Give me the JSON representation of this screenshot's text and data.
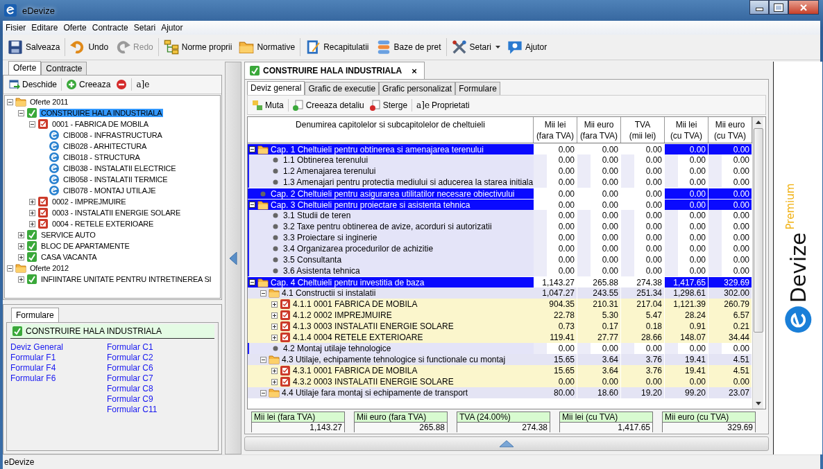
{
  "window": {
    "title": "eDevize"
  },
  "menu": [
    "Fisier",
    "Editare",
    "Oferte",
    "Contracte",
    "Setari",
    "Ajutor"
  ],
  "toolbar": [
    [
      {
        "label": "Salveaza",
        "kind": "save",
        "disabled": false,
        "dropdown": false
      }
    ],
    [
      {
        "label": "Undo",
        "kind": "undo",
        "disabled": false,
        "dropdown": false
      },
      {
        "label": "Redo",
        "kind": "redo",
        "disabled": true,
        "dropdown": false
      }
    ],
    [
      {
        "label": "Norme proprii",
        "kind": "tree",
        "disabled": false,
        "dropdown": false
      },
      {
        "label": "Normative",
        "kind": "folder",
        "disabled": false,
        "dropdown": false
      }
    ],
    [
      {
        "label": "Recapitulatii",
        "kind": "report",
        "disabled": false,
        "dropdown": false
      },
      {
        "label": "Baze de pret",
        "kind": "database",
        "disabled": false,
        "dropdown": false
      }
    ],
    [
      {
        "label": "Setari",
        "kind": "tools",
        "disabled": false,
        "dropdown": true
      },
      {
        "label": "Ajutor",
        "kind": "help",
        "disabled": false,
        "dropdown": false
      }
    ]
  ],
  "left_tabs": [
    {
      "label": "Oferte",
      "selected": true
    },
    {
      "label": "Contracte",
      "selected": false
    }
  ],
  "left_toolbar": [
    [
      {
        "label": "Deschide",
        "kind": "open"
      }
    ],
    [
      {
        "label": "Creeaza",
        "kind": "add"
      },
      {
        "kind": "remove"
      }
    ],
    [
      {
        "kind": "rename",
        "glyph": "a]e"
      }
    ]
  ],
  "tree": [
    {
      "label": "Oferte 2011",
      "kind": "folder",
      "expanded": true,
      "selected": false,
      "children": [
        {
          "label": "CONSTRUIRE HALA INDUSTRIALA",
          "kind": "project",
          "expanded": true,
          "selected": true,
          "children": [
            {
              "label": "0001 - FABRICA DE MOBILA",
              "kind": "object",
              "expanded": true,
              "selected": false,
              "children": [
                {
                  "label": "CIB008 - INFRASTRUCTURA",
                  "kind": "catalog",
                  "selected": false
                },
                {
                  "label": "CIB028 - ARHITECTURA",
                  "kind": "catalog",
                  "selected": false
                },
                {
                  "label": "CIB018 - STRUCTURA",
                  "kind": "catalog",
                  "selected": false
                },
                {
                  "label": "CIB038 - INSTALATII ELECTRICE",
                  "kind": "catalog",
                  "selected": false
                },
                {
                  "label": "CIB058 - INSTALATII TERMICE",
                  "kind": "catalog",
                  "selected": false
                },
                {
                  "label": "CIB078 - MONTAJ UTILAJE",
                  "kind": "catalog",
                  "selected": false
                }
              ]
            },
            {
              "label": "0002 - IMPREJMUIRE",
              "kind": "object",
              "expanded": false,
              "selected": false
            },
            {
              "label": "0003 - INSTALATII ENERGIE SOLARE",
              "kind": "object",
              "expanded": false,
              "selected": false
            },
            {
              "label": "0004 - RETELE EXTERIOARE",
              "kind": "object",
              "expanded": false,
              "selected": false
            }
          ]
        },
        {
          "label": "SERVICE AUTO",
          "kind": "project",
          "expanded": false,
          "selected": false
        },
        {
          "label": "BLOC DE APARTAMENTE",
          "kind": "project",
          "expanded": false,
          "selected": false
        },
        {
          "label": "CASA VACANTA",
          "kind": "project",
          "expanded": false,
          "selected": false
        }
      ]
    },
    {
      "label": "Oferte 2012",
      "kind": "folder",
      "expanded": true,
      "selected": false,
      "children": [
        {
          "label": "INFIINTARE UNITATE PENTRU INTRETINEREA SI",
          "kind": "project",
          "expanded": false,
          "selected": false
        }
      ]
    }
  ],
  "formulare": {
    "tab": "Formulare",
    "project": "CONSTRUIRE HALA INDUSTRIALA",
    "columns": [
      [
        "Deviz General",
        "Formular F1",
        "Formular F4",
        "Formular F6"
      ],
      [
        "Formular C1",
        "Formular C2",
        "Formular C6",
        "Formular C7",
        "Formular C8",
        "Formular C9",
        "Formular C11"
      ]
    ]
  },
  "document": {
    "tab": {
      "label": "CONSTRUIRE HALA INDUSTRIALA",
      "close": "×"
    },
    "tabs": [
      {
        "label": "Deviz general",
        "selected": true
      },
      {
        "label": "Grafic de executie",
        "selected": false
      },
      {
        "label": "Grafic personalizat",
        "selected": false
      },
      {
        "label": "Formulare",
        "selected": false
      }
    ],
    "toolbar": [
      [
        {
          "label": "Muta",
          "kind": "move"
        }
      ],
      [
        {
          "label": "Creeaza detaliu",
          "kind": "add-doc"
        },
        {
          "label": "Sterge",
          "kind": "delete-doc"
        }
      ],
      [
        {
          "label": "Proprietati",
          "kind": "rename",
          "glyph": "a]e"
        }
      ]
    ],
    "columns": [
      {
        "label": "Denumirea capitolelor si subcapitolelor de cheltuieli"
      },
      {
        "label": "Mii lei",
        "unit": "(fara TVA)"
      },
      {
        "label": "Mii euro",
        "unit": "(fara TVA)"
      },
      {
        "label": "TVA",
        "unit": "(mii lei)"
      },
      {
        "label": "Mii lei",
        "unit": "(cu TVA)"
      },
      {
        "label": "Mii euro",
        "unit": "(cu TVA)"
      }
    ],
    "rows": [
      {
        "kind": "chapter",
        "label": "Cap. 1 Cheltuieli pentru obtinerea si amenajarea terenului",
        "expanded": true,
        "values": [
          "0.00",
          "0.00",
          "0.00",
          "0.00",
          "0.00"
        ],
        "children": [
          {
            "kind": "item",
            "label": "1.1 Obtinerea terenului",
            "values": [
              "0.00",
              "0.00",
              "0.00",
              "0.00",
              "0.00"
            ]
          },
          {
            "kind": "item",
            "label": "1.2 Amenajarea terenului",
            "values": [
              "0.00",
              "0.00",
              "0.00",
              "0.00",
              "0.00"
            ]
          },
          {
            "kind": "item",
            "label": "1.3 Amenajari pentru protectia mediului si aducerea la starea initiala",
            "values": [
              "0.00",
              "0.00",
              "0.00",
              "0.00",
              "0.00"
            ]
          }
        ]
      },
      {
        "kind": "chapter",
        "label": "Cap. 2 Cheltuieli pentru asigurarea utilitatilor necesare obiectivului",
        "values": [
          "0.00",
          "0.00",
          "0.00",
          "0.00",
          "0.00"
        ]
      },
      {
        "kind": "chapter",
        "label": "Cap. 3 Cheltuieli pentru proiectare si asistenta tehnica",
        "expanded": true,
        "values": [
          "0.00",
          "0.00",
          "0.00",
          "0.00",
          "0.00"
        ],
        "children": [
          {
            "kind": "item",
            "label": "3.1 Studii de teren",
            "values": [
              "0.00",
              "0.00",
              "0.00",
              "0.00",
              "0.00"
            ]
          },
          {
            "kind": "item",
            "label": "3.2 Taxe pentru obtinerea de avize, acorduri si autorizatii",
            "values": [
              "0.00",
              "0.00",
              "0.00",
              "0.00",
              "0.00"
            ]
          },
          {
            "kind": "item",
            "label": "3.3 Proiectare si inginerie",
            "values": [
              "0.00",
              "0.00",
              "0.00",
              "0.00",
              "0.00"
            ]
          },
          {
            "kind": "item",
            "label": "3.4 Organizarea procedurilor de achizitie",
            "values": [
              "0.00",
              "0.00",
              "0.00",
              "0.00",
              "0.00"
            ]
          },
          {
            "kind": "item",
            "label": "3.5 Consultanta",
            "values": [
              "0.00",
              "0.00",
              "0.00",
              "0.00",
              "0.00"
            ]
          },
          {
            "kind": "item",
            "label": "3.6 Asistenta tehnica",
            "values": [
              "0.00",
              "0.00",
              "0.00",
              "0.00",
              "0.00"
            ]
          }
        ]
      },
      {
        "kind": "chapter",
        "label": "Cap. 4 Cheltuieli pentru investitia de baza",
        "expanded": true,
        "values": [
          "1,143.27",
          "265.88",
          "274.38",
          "1,417.65",
          "329.69"
        ],
        "children": [
          {
            "kind": "section",
            "label": "4.1 Constructii si instalatii",
            "expanded": true,
            "values": [
              "1,047.27",
              "243.55",
              "251.34",
              "1,298.61",
              "302.00"
            ],
            "children": [
              {
                "kind": "object",
                "label": "4.1.1 0001 FABRICA DE MOBILA",
                "expanded": false,
                "values": [
                  "904.35",
                  "210.31",
                  "217.04",
                  "1,121.39",
                  "260.79"
                ]
              },
              {
                "kind": "object",
                "label": "4.1.2 0002 IMPREJMUIRE",
                "expanded": false,
                "values": [
                  "22.78",
                  "5.30",
                  "5.47",
                  "28.24",
                  "6.57"
                ]
              },
              {
                "kind": "object",
                "label": "4.1.3 0003 INSTALATII ENERGIE SOLARE",
                "expanded": false,
                "values": [
                  "0.73",
                  "0.17",
                  "0.18",
                  "0.91",
                  "0.21"
                ]
              },
              {
                "kind": "object",
                "label": "4.1.4 0004 RETELE EXTERIOARE",
                "expanded": false,
                "values": [
                  "119.41",
                  "27.77",
                  "28.66",
                  "148.07",
                  "34.44"
                ]
              }
            ]
          },
          {
            "kind": "item",
            "label": "4.2 Montaj utilaje tehnologice",
            "values": [
              "0.00",
              "0.00",
              "0.00",
              "0.00",
              "0.00"
            ]
          },
          {
            "kind": "section",
            "label": "4.3 Utilaje, echipamente tehnologice si functionale cu montaj",
            "expanded": true,
            "values": [
              "15.65",
              "3.64",
              "3.76",
              "19.41",
              "4.51"
            ],
            "children": [
              {
                "kind": "object",
                "label": "4.3.1 0001 FABRICA DE MOBILA",
                "expanded": false,
                "values": [
                  "15.65",
                  "3.64",
                  "3.76",
                  "19.41",
                  "4.51"
                ]
              },
              {
                "kind": "object",
                "label": "4.3.2 0003 INSTALATII ENERGIE SOLARE",
                "expanded": false,
                "values": [
                  "0.00",
                  "0.00",
                  "0.00",
                  "0.00",
                  "0.00"
                ]
              }
            ]
          },
          {
            "kind": "section",
            "label": "4.4 Utilaje fara montaj si echipamente de transport",
            "expanded": true,
            "values": [
              "80.00",
              "18.60",
              "19.20",
              "99.20",
              "23.07"
            ]
          }
        ]
      }
    ],
    "totals": [
      {
        "label": "Mii lei (fara TVA)",
        "value": "1,143.27"
      },
      {
        "label": "Mii euro (fara TVA)",
        "value": "265.88"
      },
      {
        "label": "TVA (24.00%)",
        "value": "274.38"
      },
      {
        "label": "Mii lei (cu TVA)",
        "value": "1,417.65"
      },
      {
        "label": "Mii euro (cu TVA)",
        "value": "329.69"
      }
    ]
  },
  "logo": {
    "name": "Devize",
    "edition": "Premium"
  },
  "status_bar": "eDevize"
}
